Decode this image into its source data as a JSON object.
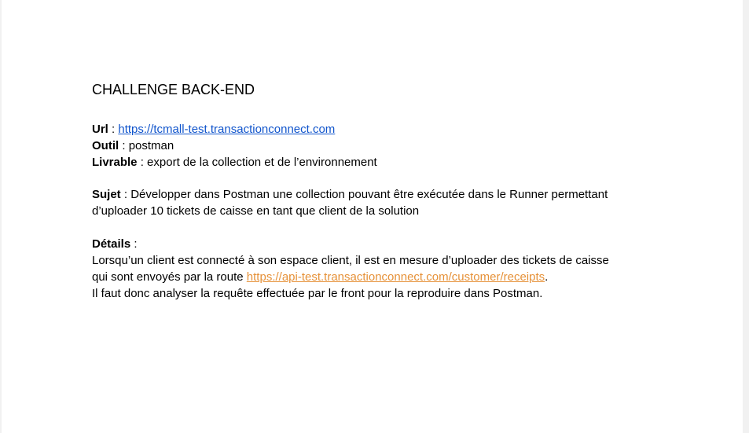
{
  "document": {
    "title": "CHALLENGE BACK-END",
    "info": {
      "url_label": "Url",
      "url_sep": " : ",
      "url_value": "https://tcmall-test.transactionconnect.com",
      "tool_label": "Outil",
      "tool_sep": " : ",
      "tool_value": "postman",
      "deliverable_label": "Livrable",
      "deliverable_sep": " : ",
      "deliverable_value": "export de la collection et de l’environnement"
    },
    "subject": {
      "label": "Sujet",
      "line1_rest": " : Développer dans Postman une collection pouvant être exécutée dans le Runner permettant",
      "line2": "d’uploader 10 tickets de caisse en tant que client de la solution"
    },
    "details": {
      "label": "Détails",
      "label_sep": " :",
      "line1": "Lorsqu’un client est connecté à son espace client, il est en mesure d’uploader des tickets de caisse",
      "line2_prefix": "qui sont envoyés par la route ",
      "line2_link": "https://api-test.transactionconnect.com/customer/receipts",
      "line2_suffix": ".",
      "line3": "Il faut donc analyser la requête effectuée par le front pour la reproduire dans Postman."
    }
  },
  "colors": {
    "link_blue": "#1155cc",
    "link_orange": "#e69138",
    "page_bg": "#ffffff",
    "outer_bg": "#f1f1f1"
  }
}
